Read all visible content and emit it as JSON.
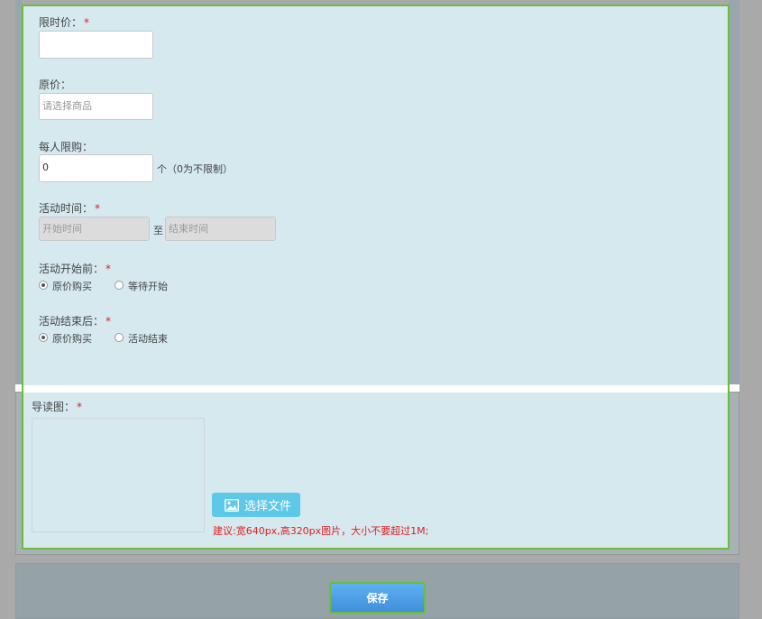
{
  "form": {
    "flash_price": {
      "label": "限时价：",
      "required": "*",
      "value": ""
    },
    "original_price": {
      "label": "原价：",
      "placeholder": "请选择商品"
    },
    "limit_per_person": {
      "label": "每人限购：",
      "value": "0",
      "suffix": "个（0为不限制）"
    },
    "activity_time": {
      "label": "活动时间：",
      "required": "*",
      "start_placeholder": "开始时间",
      "separator": "至",
      "end_placeholder": "结束时间"
    },
    "before_start": {
      "label": "活动开始前：",
      "required": "*",
      "options": [
        {
          "label": "原价购买",
          "checked": true
        },
        {
          "label": "等待开始",
          "checked": false
        }
      ]
    },
    "after_end": {
      "label": "活动结束后：",
      "required": "*",
      "options": [
        {
          "label": "原价购买",
          "checked": true
        },
        {
          "label": "活动结束",
          "checked": false
        }
      ]
    },
    "cover_image": {
      "label": "导读图：",
      "required": "*",
      "choose_button": "选择文件",
      "hint": "建议:宽640px,高320px图片，大小不要超过1M;"
    }
  },
  "footer": {
    "save_label": "保存"
  },
  "colors": {
    "accent_border": "#6bbd3a",
    "panel_bg": "#d5e9ef",
    "required": "#e02020",
    "button_blue": "#3f8fdc",
    "file_button": "#5ec8e8"
  }
}
